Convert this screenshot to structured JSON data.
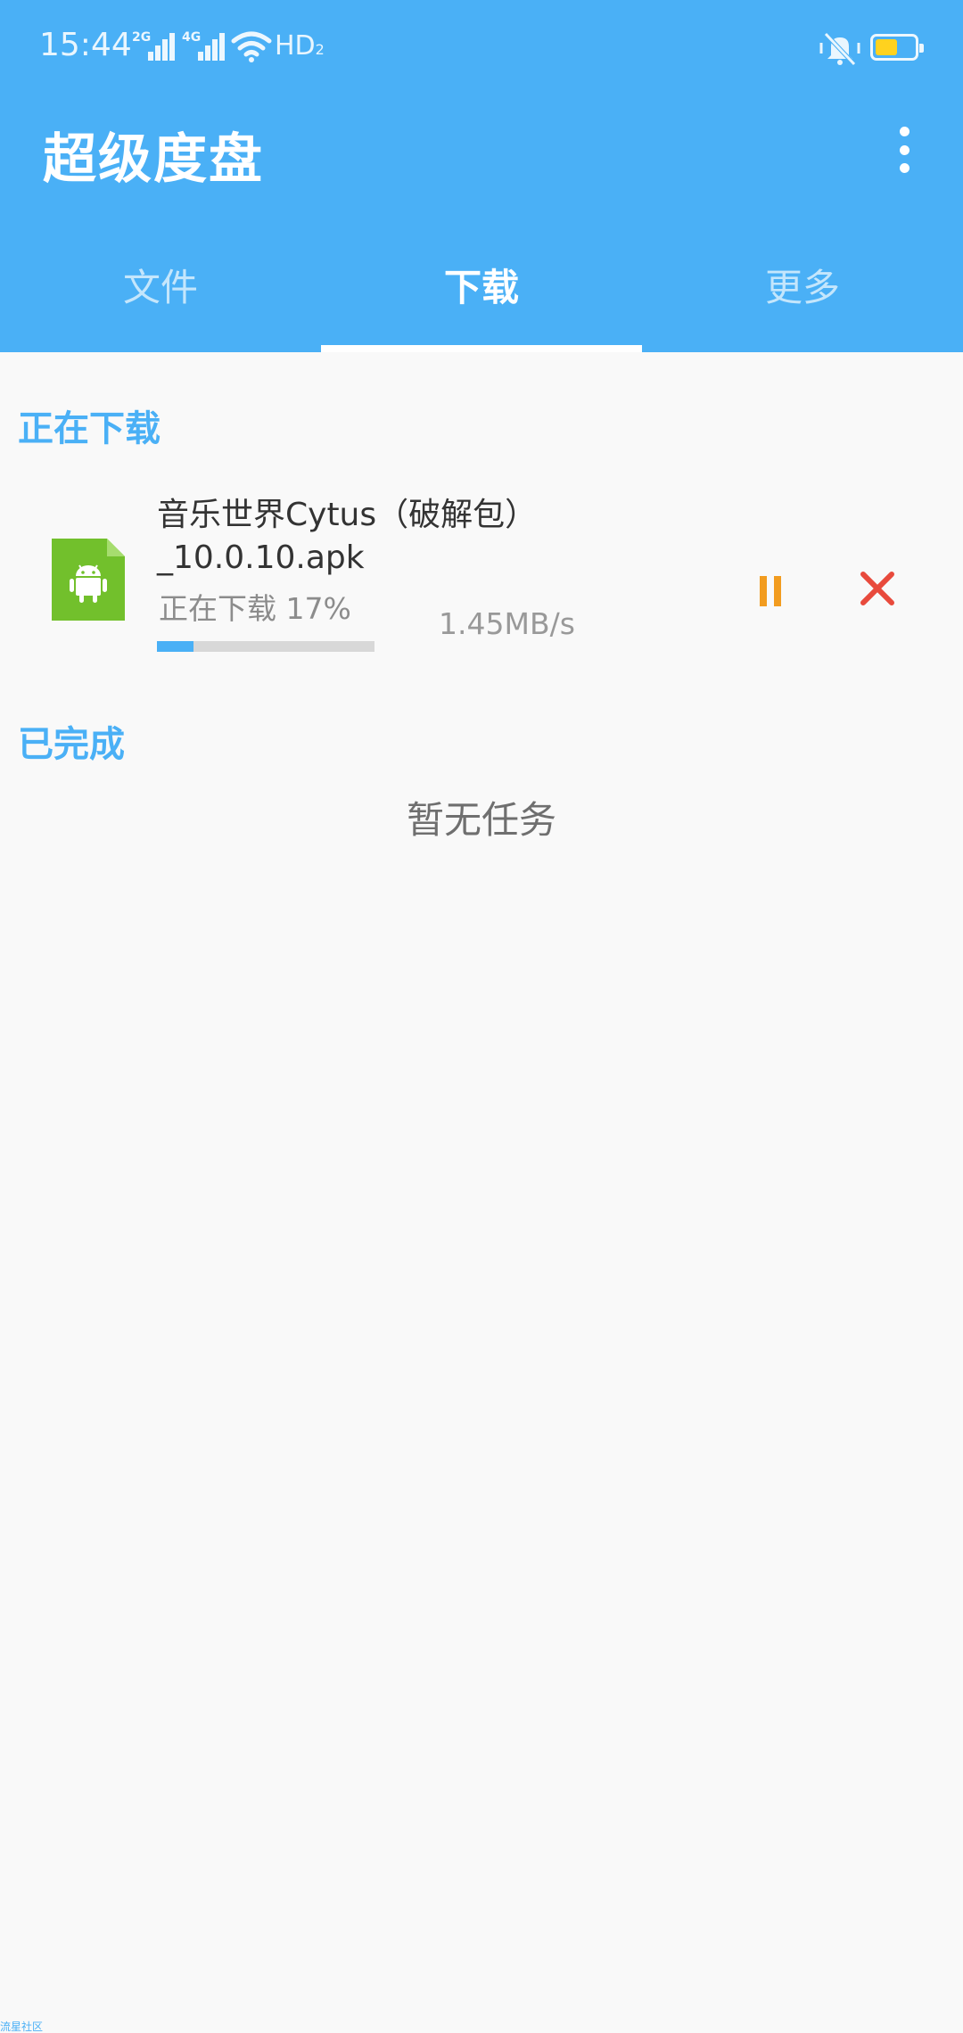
{
  "status_bar": {
    "time": "15:44",
    "signal_1_label": "2G",
    "signal_2_label": "4G",
    "network_label": "HD",
    "network_sub": "2",
    "battery_color": "#ffd21f"
  },
  "app_bar": {
    "title": "超级度盘",
    "more_icon": "more-vert-icon"
  },
  "tabs": [
    {
      "label": "文件",
      "active": false
    },
    {
      "label": "下载",
      "active": true
    },
    {
      "label": "更多",
      "active": false
    }
  ],
  "downloading": {
    "section_title": "正在下载",
    "items": [
      {
        "file_name": "音乐世界Cytus（破解包）_10.0.10.apk",
        "status": "正在下载 17%",
        "progress": 0.17,
        "speed": "1.45MB/s",
        "file_icon": "android-apk-icon",
        "pause_icon": "pause-icon",
        "cancel_icon": "close-icon"
      }
    ]
  },
  "completed": {
    "section_title": "已完成",
    "empty_text": "暂无任务"
  },
  "watermark": "流星社区",
  "colors": {
    "primary": "#4ab0f6",
    "pause": "#f29c1f",
    "cancel": "#e84a3c",
    "apk_icon": "#72c02c"
  }
}
